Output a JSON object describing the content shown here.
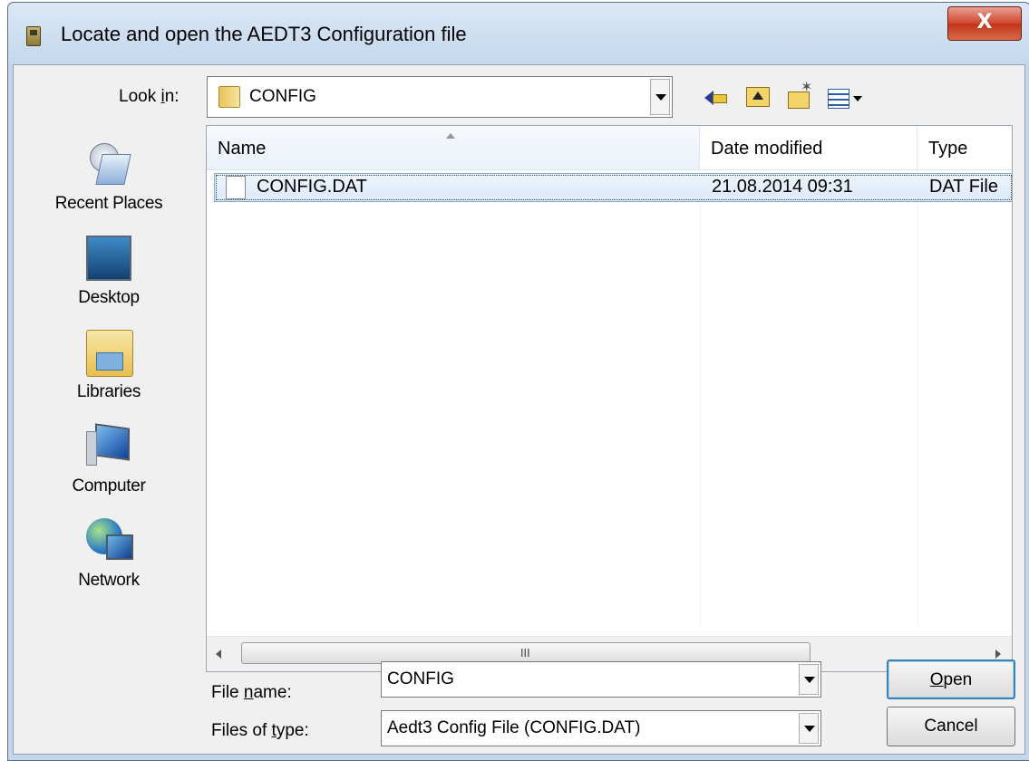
{
  "window": {
    "title": "Locate and open the AEDT3 Configuration file",
    "close_glyph": "X"
  },
  "toolbar": {
    "look_in_label_pre": "Look ",
    "look_in_label_key": "i",
    "look_in_label_post": "n:",
    "look_in_value": "CONFIG",
    "icons": [
      "back-icon",
      "up-folder-icon",
      "new-folder-icon",
      "views-menu-icon"
    ]
  },
  "places": [
    {
      "label": "Recent Places",
      "icon": "recent-places-icon"
    },
    {
      "label": "Desktop",
      "icon": "desktop-icon"
    },
    {
      "label": "Libraries",
      "icon": "libraries-icon"
    },
    {
      "label": "Computer",
      "icon": "computer-icon"
    },
    {
      "label": "Network",
      "icon": "network-icon"
    }
  ],
  "file_list": {
    "columns": [
      "Name",
      "Date modified",
      "Type"
    ],
    "rows": [
      {
        "name": "CONFIG.DAT",
        "date": "21.08.2014 09:31",
        "type": "DAT File"
      }
    ],
    "scroll_grip": "III"
  },
  "file_name": {
    "label_pre": "File ",
    "label_key": "n",
    "label_post": "ame:",
    "value": "CONFIG"
  },
  "file_type": {
    "label_pre": "Files of ",
    "label_key": "t",
    "label_post": "ype:",
    "value": "Aedt3 Config File (CONFIG.DAT)"
  },
  "buttons": {
    "open_key": "O",
    "open_rest": "pen",
    "cancel": "Cancel"
  },
  "colors": {
    "title_bar": "#c4d7ec",
    "close_button": "#c23418",
    "selection": "#dbe9f8"
  }
}
